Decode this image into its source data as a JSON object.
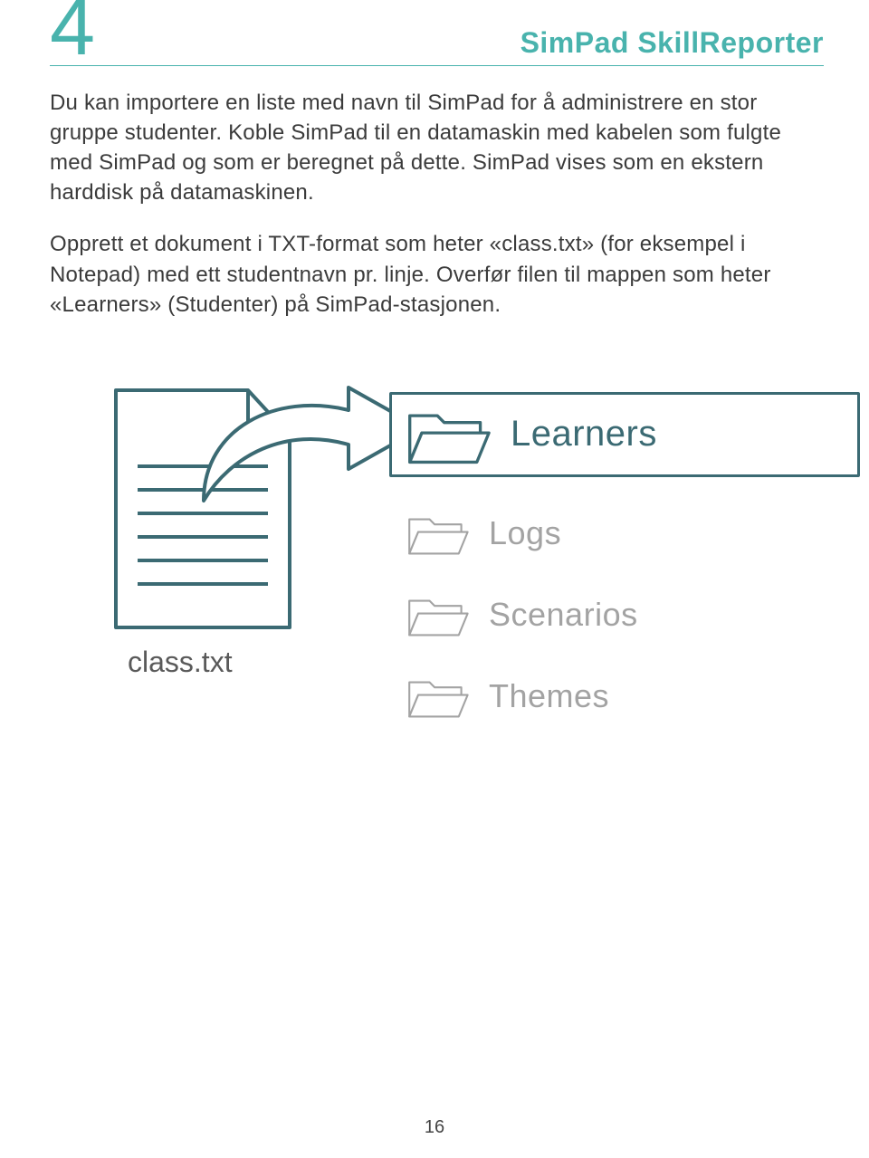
{
  "header": {
    "section_number": "4",
    "product_title": "SimPad SkillReporter"
  },
  "paragraphs": {
    "p1": "Du kan importere en liste med navn til SimPad for å administrere en stor gruppe studenter. Koble SimPad til en datamaskin med kabelen som fulgte med SimPad og som er beregnet på dette. SimPad vises som en ekstern harddisk på datamaskinen.",
    "p2": "Opprett et dokument i TXT-format som heter «class.txt» (for eksempel i Notepad) med ett studentnavn pr. linje. Overfør filen til mappen som heter «Learners» (Studenter) på SimPad-stasjonen."
  },
  "diagram": {
    "file_label": "class.txt",
    "folders": [
      {
        "label": "Learners",
        "selected": true
      },
      {
        "label": "Logs",
        "selected": false
      },
      {
        "label": "Scenarios",
        "selected": false
      },
      {
        "label": "Themes",
        "selected": false
      }
    ]
  },
  "page_number": "16",
  "colors": {
    "accent": "#49b3ad",
    "dark_teal": "#3b6a73",
    "muted": "#a3a3a3"
  }
}
